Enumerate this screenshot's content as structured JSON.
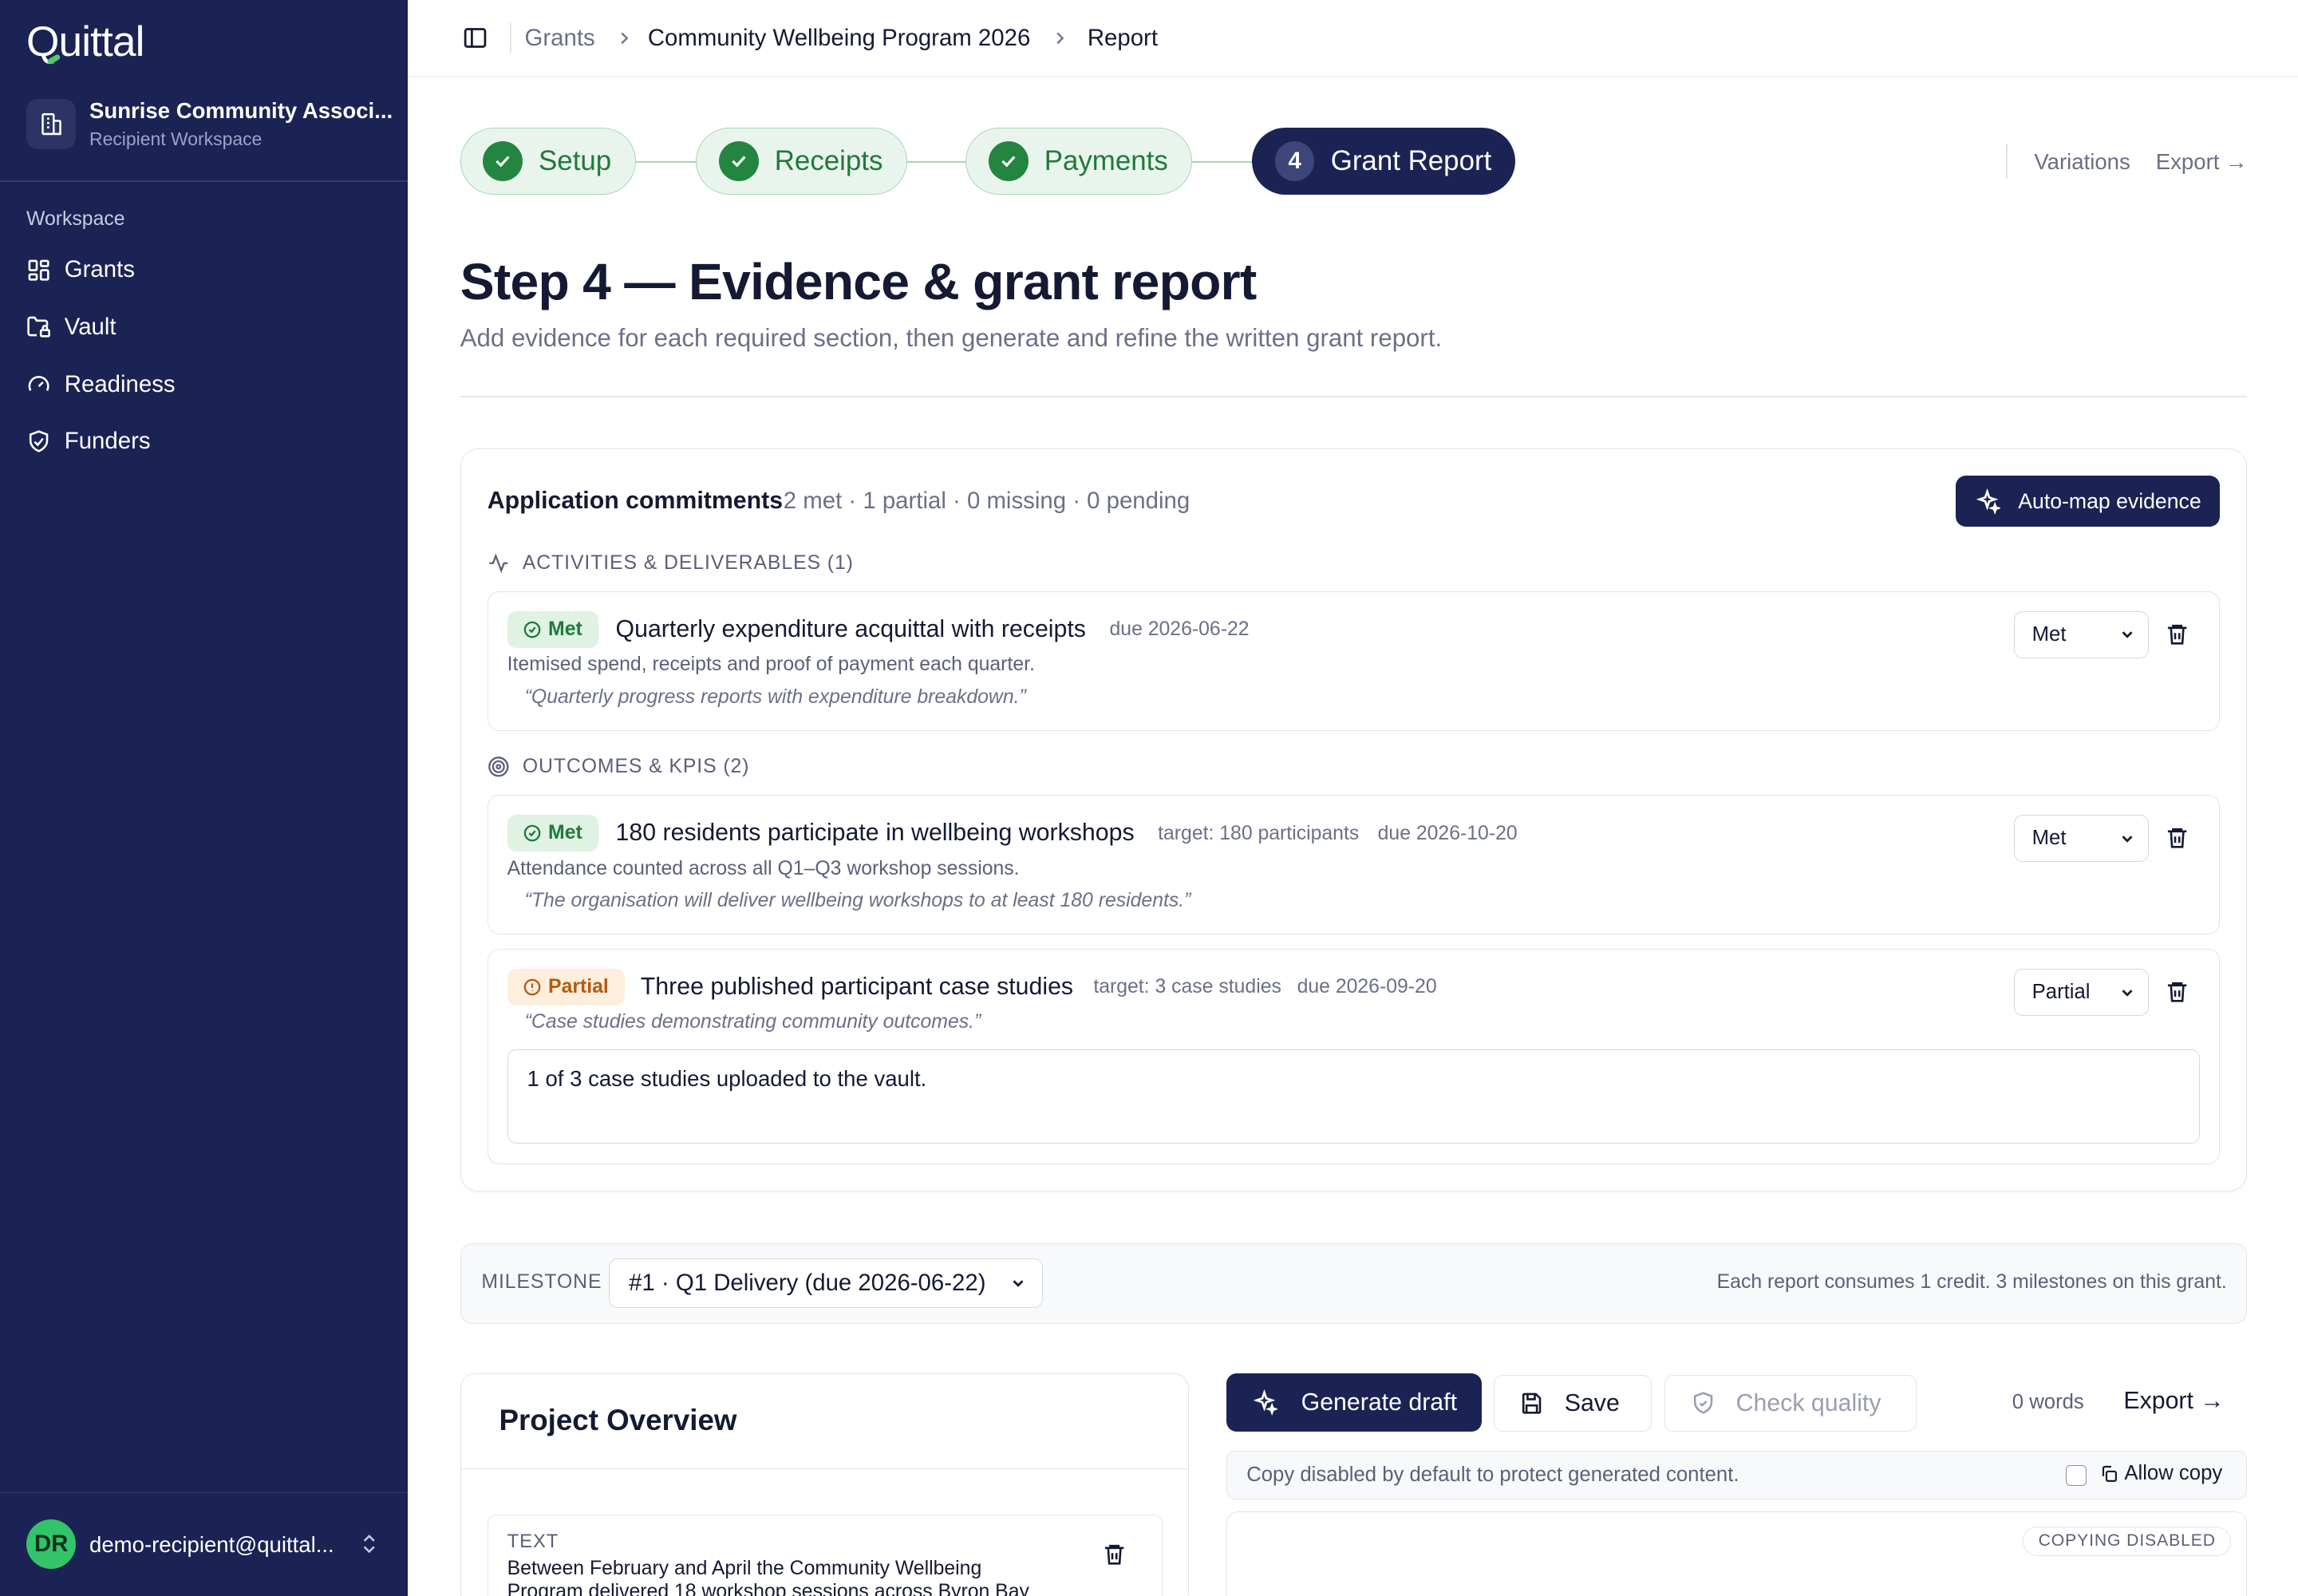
{
  "sidebar": {
    "logo": "Quittal",
    "org_name": "Sunrise Community Associ...",
    "org_sub": "Recipient Workspace",
    "section": "Workspace",
    "items": [
      {
        "label": "Grants",
        "icon": "grid-icon"
      },
      {
        "label": "Vault",
        "icon": "folder-lock-icon"
      },
      {
        "label": "Readiness",
        "icon": "gauge-icon"
      },
      {
        "label": "Funders",
        "icon": "handshake-icon"
      }
    ],
    "user_initials": "DR",
    "user_email": "demo-recipient@quittal..."
  },
  "breadcrumb": [
    "Grants",
    "Community Wellbeing Program 2026",
    "Report"
  ],
  "steps": [
    {
      "label": "Setup",
      "state": "done"
    },
    {
      "label": "Receipts",
      "state": "done"
    },
    {
      "label": "Payments",
      "state": "done"
    },
    {
      "label": "Grant Report",
      "state": "active",
      "number": "4"
    }
  ],
  "header_links": {
    "variations": "Variations",
    "export": "Export →"
  },
  "page": {
    "title": "Step 4 — Evidence & grant report",
    "subtitle": "Add evidence for each required section, then generate and refine the written grant report."
  },
  "commitments": {
    "title": "Application commitments",
    "summary": "2 met · 1 partial · 0 missing · 0 pending",
    "automap_label": "Auto-map evidence",
    "sections": [
      {
        "title": "ACTIVITIES & DELIVERABLES (1)",
        "items": [
          {
            "status": "Met",
            "title": "Quarterly expenditure acquittal with receipts",
            "due": "due 2026-06-22",
            "desc": "Itemised spend, receipts and proof of payment each quarter.",
            "quote": "“Quarterly progress reports with expenditure breakdown.”",
            "select": "Met"
          }
        ]
      },
      {
        "title": "OUTCOMES & KPIS (2)",
        "items": [
          {
            "status": "Met",
            "title": "180 residents participate in wellbeing workshops",
            "target": "target: 180 participants",
            "due": "due 2026-10-20",
            "desc": "Attendance counted across all Q1–Q3 workshop sessions.",
            "quote": "“The organisation will deliver wellbeing workshops to at least 180 residents.”",
            "select": "Met"
          },
          {
            "status": "Partial",
            "title": "Three published participant case studies",
            "target": "target: 3 case studies",
            "due": "due 2026-09-20",
            "quote": "“Case studies demonstrating community outcomes.”",
            "select": "Partial",
            "note": "1 of 3 case studies uploaded to the vault."
          }
        ]
      }
    ]
  },
  "milestone": {
    "label": "MILESTONE",
    "selected": "#1 · Q1 Delivery (due 2026-06-22)",
    "note": "Each report consumes 1 credit. 3 milestones on this grant."
  },
  "overview": {
    "title": "Project Overview",
    "block_label": "TEXT",
    "block_text": "Between February and April the Community Wellbeing Program delivered 18 workshop sessions across Byron Bay"
  },
  "editor": {
    "generate_label": "Generate draft",
    "save_label": "Save",
    "check_label": "Check quality",
    "words": "0 words",
    "export_label": "Export →",
    "copy_msg": "Copy disabled by default to protect generated content.",
    "allow_copy": "Allow copy",
    "copy_badge": "COPYING DISABLED"
  },
  "colors": {
    "sidebar": "#1b2354",
    "accent": "#1b2354",
    "success": "#23853f",
    "warning": "#b65a0c"
  }
}
